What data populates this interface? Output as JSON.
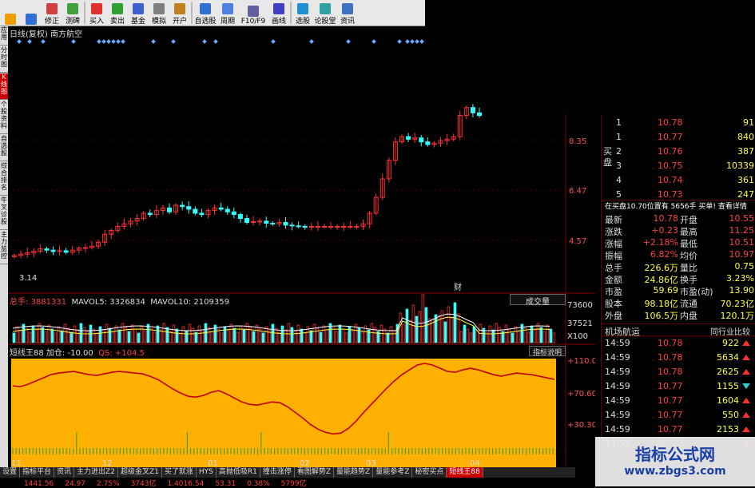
{
  "toolbar": {
    "buttons": [
      {
        "label": "",
        "icon": "back-arrow-icon"
      },
      {
        "label": "",
        "icon": "forward-arrow-icon"
      },
      {
        "label": "修正",
        "icon": "edit-icon"
      },
      {
        "label": "测碑",
        "icon": "measure-icon"
      },
      {
        "label": "买入",
        "icon": "buy-icon"
      },
      {
        "label": "卖出",
        "icon": "sell-icon"
      },
      {
        "label": "基金",
        "icon": "fund-icon"
      },
      {
        "label": "模拟",
        "icon": "simulate-icon"
      },
      {
        "label": "开户",
        "icon": "account-icon"
      },
      {
        "label": "自选股",
        "icon": "favorites-icon"
      },
      {
        "label": "周期",
        "icon": "period-icon"
      },
      {
        "label": "F10/F9",
        "icon": "f10-icon"
      },
      {
        "label": "画线",
        "icon": "draw-line-icon"
      },
      {
        "label": "选股",
        "icon": "stock-picker-icon"
      },
      {
        "label": "论股堂",
        "icon": "forum-icon"
      },
      {
        "label": "资讯",
        "icon": "news-icon"
      }
    ]
  },
  "left_tabs": [
    "应用",
    "分时图",
    "K线图",
    "个股资料",
    "自选股",
    "综合排名",
    "牛叉诊股",
    "主力监控"
  ],
  "title": "日线(复权) 南方航空",
  "axis": {
    "price_ticks": [
      "8.35",
      "6.47",
      "4.57"
    ],
    "low_label": "3.14",
    "vol_ticks": [
      "73600",
      "37521",
      "X100"
    ],
    "ind_ticks": [
      "+110.0",
      "+70.60",
      "+30.30"
    ],
    "dates": [
      "11",
      "12",
      "01",
      "02",
      "03",
      "04"
    ],
    "fin_label": "财"
  },
  "volume_info": {
    "total": "总手: 3881331",
    "mavol5": "MAVOL5: 3326834",
    "mavol10": "MAVOL10: 2109359",
    "mode": "成交量"
  },
  "indicator_info": {
    "name": "短线王88",
    "add": "加仓: -10.00",
    "qs": "QS: +104.5",
    "help": "指标说明"
  },
  "bottom_tabs": [
    "设置",
    "指标平台",
    "资讯",
    "主力进出Z2",
    "超级金叉Z1",
    "买了就涨",
    "HYS",
    "高抛低吸R1",
    "撞击涨停",
    "看图解势Z",
    "量能趋势Z",
    "量能参考Z",
    "秘密买点",
    "短线王88"
  ],
  "bottom_status": [
    "1441.56",
    "24.97",
    "2.75%",
    "3743亿",
    "1.4016.54",
    "53.31",
    "0.38%",
    "5799亿"
  ],
  "orderbook": {
    "side_label": "买盘",
    "rows": [
      {
        "level": "1",
        "price": "10.78",
        "vol": "91"
      },
      {
        "level": "1",
        "price": "10.77",
        "vol": "840"
      },
      {
        "level": "2",
        "price": "10.76",
        "vol": "387"
      },
      {
        "level": "3",
        "price": "10.75",
        "vol": "10339"
      },
      {
        "level": "4",
        "price": "10.74",
        "vol": "361"
      },
      {
        "level": "5",
        "price": "10.73",
        "vol": "247"
      }
    ]
  },
  "bid_info": "在买盘10.70位置有 5656手 买单! 查看详情",
  "quote_rows": [
    {
      "l1": "最新",
      "v1": "10.78",
      "l2": "开盘",
      "v2": "10.55"
    },
    {
      "l1": "涨跌",
      "v1": "+0.23",
      "l2": "最高",
      "v2": "11.25"
    },
    {
      "l1": "涨幅",
      "v1": "+2.18%",
      "l2": "最低",
      "v2": "10.51"
    },
    {
      "l1": "振幅",
      "v1": "6.82%",
      "l2": "均价",
      "v2": "10.97"
    },
    {
      "l1": "总手",
      "v1": "226.6万",
      "l2": "量比",
      "v2": "0.75"
    },
    {
      "l1": "金额",
      "v1": "24.86亿",
      "l2": "换手",
      "v2": "3.23%"
    },
    {
      "l1": "市盈",
      "v1": "59.69",
      "l2": "市盈(动)",
      "v2": "13.90"
    },
    {
      "l1": "股本",
      "v1": "98.18亿",
      "l2": "流通",
      "v2": "70.23亿"
    },
    {
      "l1": "外盘",
      "v1": "106.5万",
      "l2": "内盘",
      "v2": "120.1万"
    }
  ],
  "sector": {
    "name": "机场航运",
    "compare": "同行业比较"
  },
  "ticks": [
    {
      "t": "14:59",
      "p": "10.78",
      "v": "922"
    },
    {
      "t": "14:59",
      "p": "10.78",
      "v": "5634"
    },
    {
      "t": "14:59",
      "p": "10.78",
      "v": "2625"
    },
    {
      "t": "14:59",
      "p": "10.77",
      "v": "1155"
    },
    {
      "t": "14:59",
      "p": "10.77",
      "v": "1604"
    },
    {
      "t": "14:59",
      "p": "10.77",
      "v": "550"
    },
    {
      "t": "14:59",
      "p": "10.77",
      "v": "2153"
    },
    {
      "t": "14:59",
      "p": "10.78",
      "v": ""
    }
  ],
  "watermark": {
    "line1": "指标公式网",
    "line2": "www.zbgs3.com"
  },
  "colors": {
    "up": "#ff3030",
    "down": "#30ffff",
    "panel": "#ffb000",
    "line": "#c00000",
    "wm": "#1a3fa6"
  },
  "kline": [
    4.0,
    4.05,
    4.1,
    4.16,
    4.25,
    4.2,
    4.15,
    4.18,
    4.12,
    4.2,
    4.28,
    4.3,
    4.35,
    4.5,
    4.8,
    4.95,
    5.1,
    5.2,
    5.3,
    5.4,
    5.6,
    5.55,
    5.7,
    5.8,
    5.65,
    5.9,
    5.85,
    5.75,
    5.6,
    5.55,
    5.7,
    5.8,
    5.75,
    5.65,
    5.55,
    5.4,
    5.25,
    5.28,
    5.3,
    5.22,
    5.2,
    5.25,
    5.15,
    5.12,
    5.1,
    5.08,
    5.1,
    5.1,
    5.1,
    5.1,
    5.1,
    5.1,
    5.1,
    5.1,
    5.2,
    5.6,
    6.2,
    6.9,
    7.6,
    8.3,
    8.5,
    8.4,
    8.45,
    8.3,
    8.2,
    8.25,
    8.35,
    8.4,
    8.5,
    9.3,
    9.6,
    9.4,
    9.3
  ],
  "qs": [
    78,
    77,
    80,
    84,
    88,
    92,
    94,
    95,
    96,
    94,
    92,
    91,
    93,
    95,
    96,
    95,
    94,
    93,
    90,
    86,
    80,
    74,
    69,
    65,
    64,
    66,
    70,
    72,
    68,
    63,
    58,
    55,
    54,
    56,
    58,
    57,
    52,
    45,
    38,
    30,
    24,
    20,
    18,
    19,
    25,
    34,
    45,
    55,
    65,
    75,
    84,
    92,
    98,
    104,
    106,
    104,
    100,
    96,
    95,
    98,
    100,
    98,
    95,
    92,
    90,
    92,
    94,
    93,
    92,
    90,
    88,
    86
  ]
}
